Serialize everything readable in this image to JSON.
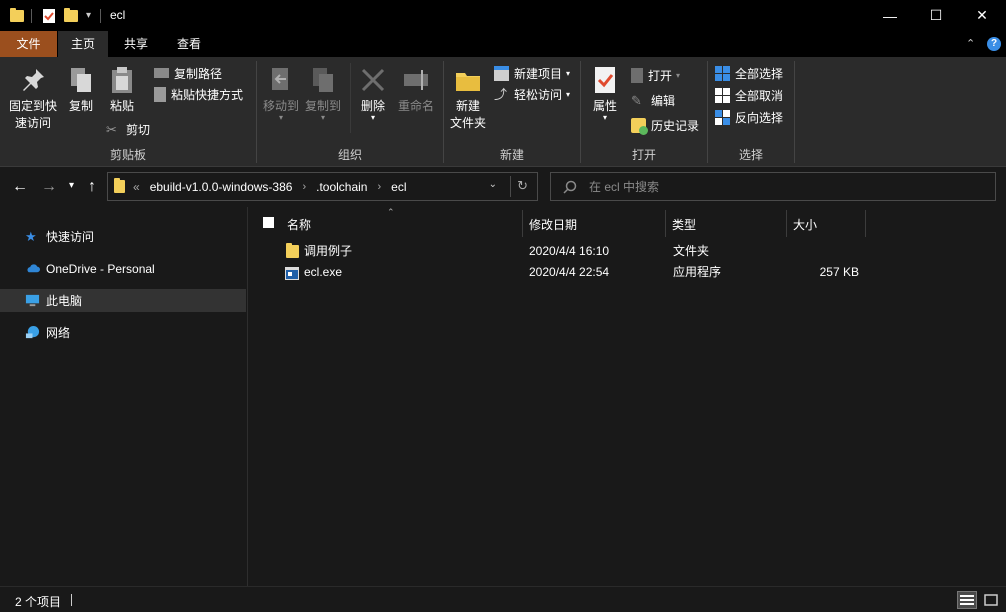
{
  "window": {
    "title": "ecl",
    "minimize": "—",
    "maximize": "☐",
    "close": "✕"
  },
  "ribbon_tabs": [
    "文件",
    "主页",
    "共享",
    "查看"
  ],
  "ribbon": {
    "clipboard": {
      "pin_label_1": "固定到快",
      "pin_label_2": "速访问",
      "copy": "复制",
      "paste": "粘贴",
      "copy_path": "复制路径",
      "paste_shortcut": "粘贴快捷方式",
      "cut": "剪切",
      "group": "剪贴板"
    },
    "organize": {
      "move_to": "移动到",
      "copy_to": "复制到",
      "delete": "删除",
      "rename": "重命名",
      "group": "组织"
    },
    "new": {
      "new_folder_1": "新建",
      "new_folder_2": "文件夹",
      "new_item": "新建项目",
      "easy_access": "轻松访问",
      "group": "新建"
    },
    "open": {
      "properties": "属性",
      "open": "打开",
      "edit": "编辑",
      "history": "历史记录",
      "group": "打开"
    },
    "select": {
      "select_all": "全部选择",
      "select_none": "全部取消",
      "invert": "反向选择",
      "group": "选择"
    }
  },
  "address": {
    "overflow": "«",
    "crumbs": [
      "ebuild-v1.0.0-windows-386",
      ".toolchain",
      "ecl"
    ],
    "separator": "›"
  },
  "search": {
    "placeholder": "在 ecl 中搜索"
  },
  "sidebar": {
    "items": [
      {
        "label": "快速访问",
        "icon": "star-icon"
      },
      {
        "label": "OneDrive - Personal",
        "icon": "cloud-icon"
      },
      {
        "label": "此电脑",
        "icon": "computer-icon"
      },
      {
        "label": "网络",
        "icon": "network-icon"
      }
    ]
  },
  "columns": {
    "name": "名称",
    "date": "修改日期",
    "type": "类型",
    "size": "大小"
  },
  "files": [
    {
      "name": "调用例子",
      "date": "2020/4/4 16:10",
      "type": "文件夹",
      "size": "",
      "icon": "folder-icon"
    },
    {
      "name": "ecl.exe",
      "date": "2020/4/4 22:54",
      "type": "应用程序",
      "size": "257 KB",
      "icon": "exe-icon"
    }
  ],
  "status": {
    "count": "2 个项目"
  },
  "colors": {
    "file_tab": "#9b4f1e",
    "background": "#191919",
    "ribbon": "#2b2b2b",
    "folder": "#f3cf5a",
    "accent_blue": "#3a8ee6"
  }
}
